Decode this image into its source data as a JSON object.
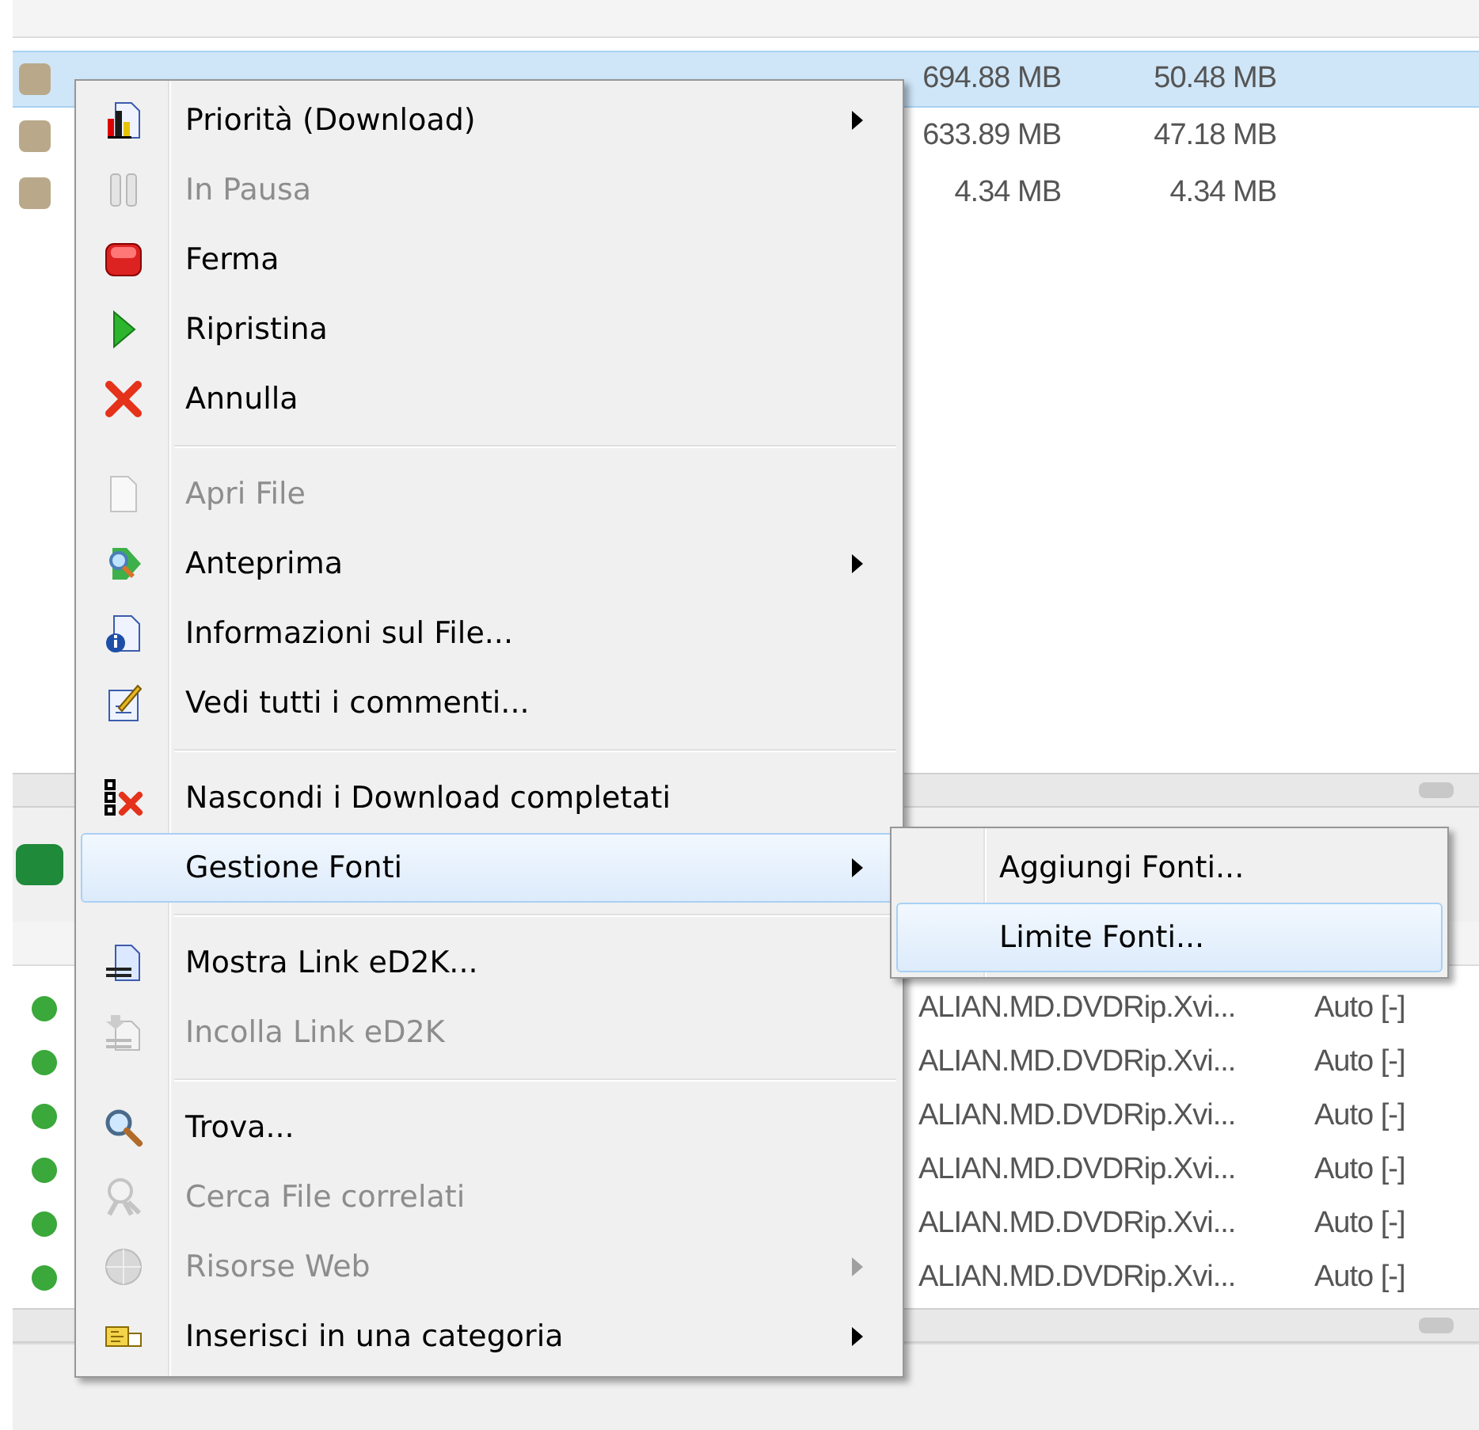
{
  "top_list": {
    "rows": [
      {
        "size": "694.88 MB",
        "completed": "50.48 MB",
        "selected": true
      },
      {
        "size": "633.89 MB",
        "completed": "47.18 MB",
        "selected": false
      },
      {
        "size": "4.34 MB",
        "completed": "4.34 MB",
        "selected": false
      }
    ]
  },
  "bottom_list": {
    "rows": [
      {
        "name": "ALIAN.MD.DVDRip.Xvi...",
        "priority": "Auto [-]"
      },
      {
        "name": "ALIAN.MD.DVDRip.Xvi...",
        "priority": "Auto [-]"
      },
      {
        "name": "ALIAN.MD.DVDRip.Xvi...",
        "priority": "Auto [-]"
      },
      {
        "name": "ALIAN.MD.DVDRip.Xvi...",
        "priority": "Auto [-]"
      },
      {
        "name": "ALIAN.MD.DVDRip.Xvi...",
        "priority": "Auto [-]"
      },
      {
        "name": "ALIAN.MD.DVDRip.Xvi...",
        "priority": "Auto [-]"
      }
    ]
  },
  "context_menu": {
    "items": [
      {
        "kind": "item",
        "label": "Priorità (Download)",
        "disabled": false,
        "submenu": true,
        "selected": false
      },
      {
        "kind": "item",
        "label": "In Pausa",
        "disabled": true,
        "submenu": false,
        "selected": false
      },
      {
        "kind": "item",
        "label": "Ferma",
        "disabled": false,
        "submenu": false,
        "selected": false
      },
      {
        "kind": "item",
        "label": "Ripristina",
        "disabled": false,
        "submenu": false,
        "selected": false
      },
      {
        "kind": "item",
        "label": "Annulla",
        "disabled": false,
        "submenu": false,
        "selected": false
      },
      {
        "kind": "separator"
      },
      {
        "kind": "item",
        "label": "Apri File",
        "disabled": true,
        "submenu": false,
        "selected": false
      },
      {
        "kind": "item",
        "label": "Anteprima",
        "disabled": false,
        "submenu": true,
        "selected": false
      },
      {
        "kind": "item",
        "label": "Informazioni sul File...",
        "disabled": false,
        "submenu": false,
        "selected": false
      },
      {
        "kind": "item",
        "label": "Vedi tutti i commenti...",
        "disabled": false,
        "submenu": false,
        "selected": false
      },
      {
        "kind": "separator"
      },
      {
        "kind": "item",
        "label": "Nascondi i Download completati",
        "disabled": false,
        "submenu": false,
        "selected": false
      },
      {
        "kind": "item",
        "label": "Gestione Fonti",
        "disabled": false,
        "submenu": true,
        "selected": true
      },
      {
        "kind": "separator"
      },
      {
        "kind": "item",
        "label": "Mostra Link eD2K...",
        "disabled": false,
        "submenu": false,
        "selected": false
      },
      {
        "kind": "item",
        "label": "Incolla Link eD2K",
        "disabled": true,
        "submenu": false,
        "selected": false
      },
      {
        "kind": "separator"
      },
      {
        "kind": "item",
        "label": "Trova...",
        "disabled": false,
        "submenu": false,
        "selected": false
      },
      {
        "kind": "item",
        "label": "Cerca File correlati",
        "disabled": true,
        "submenu": false,
        "selected": false
      },
      {
        "kind": "item",
        "label": "Risorse Web",
        "disabled": true,
        "submenu": true,
        "selected": false
      },
      {
        "kind": "item",
        "label": "Inserisci in una categoria",
        "disabled": false,
        "submenu": true,
        "selected": false
      }
    ]
  },
  "submenu": {
    "items": [
      {
        "label": "Aggiungi Fonti...",
        "selected": false
      },
      {
        "label": "Limite Fonti...",
        "selected": true
      }
    ]
  }
}
